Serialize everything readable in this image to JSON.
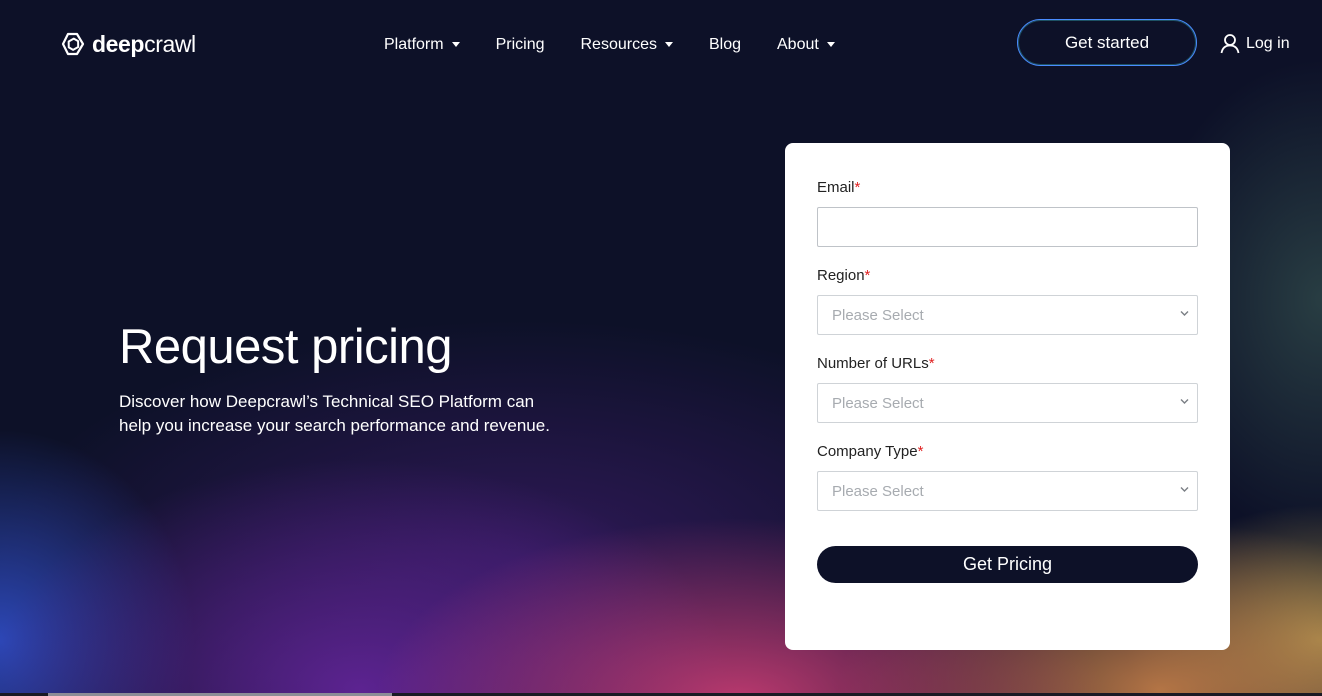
{
  "header": {
    "logo": {
      "bold": "deep",
      "light": "crawl"
    },
    "nav": [
      {
        "label": "Platform",
        "dropdown": true
      },
      {
        "label": "Pricing",
        "dropdown": false
      },
      {
        "label": "Resources",
        "dropdown": true
      },
      {
        "label": "Blog",
        "dropdown": false
      },
      {
        "label": "About",
        "dropdown": true
      }
    ],
    "cta_label": "Get started",
    "login_label": "Log in"
  },
  "hero": {
    "title": "Request pricing",
    "description": "Discover how Deepcrawl’s Technical SEO Platform can help you increase your search performance and revenue."
  },
  "form": {
    "required_marker": "*",
    "email": {
      "label": "Email",
      "value": ""
    },
    "region": {
      "label": "Region",
      "placeholder": "Please Select"
    },
    "urls": {
      "label": "Number of URLs",
      "placeholder": "Please Select"
    },
    "company_type": {
      "label": "Company Type",
      "placeholder": "Please Select"
    },
    "submit_label": "Get Pricing"
  },
  "colors": {
    "background": "#0d1128",
    "cta_border": "#4a8cff",
    "required": "#e02020",
    "submit_bg": "#0d1128"
  },
  "icons": {
    "logo": "deepcrawl-logo-icon",
    "caret": "caret-down-icon",
    "login": "user-icon",
    "select": "chevron-down-icon"
  }
}
